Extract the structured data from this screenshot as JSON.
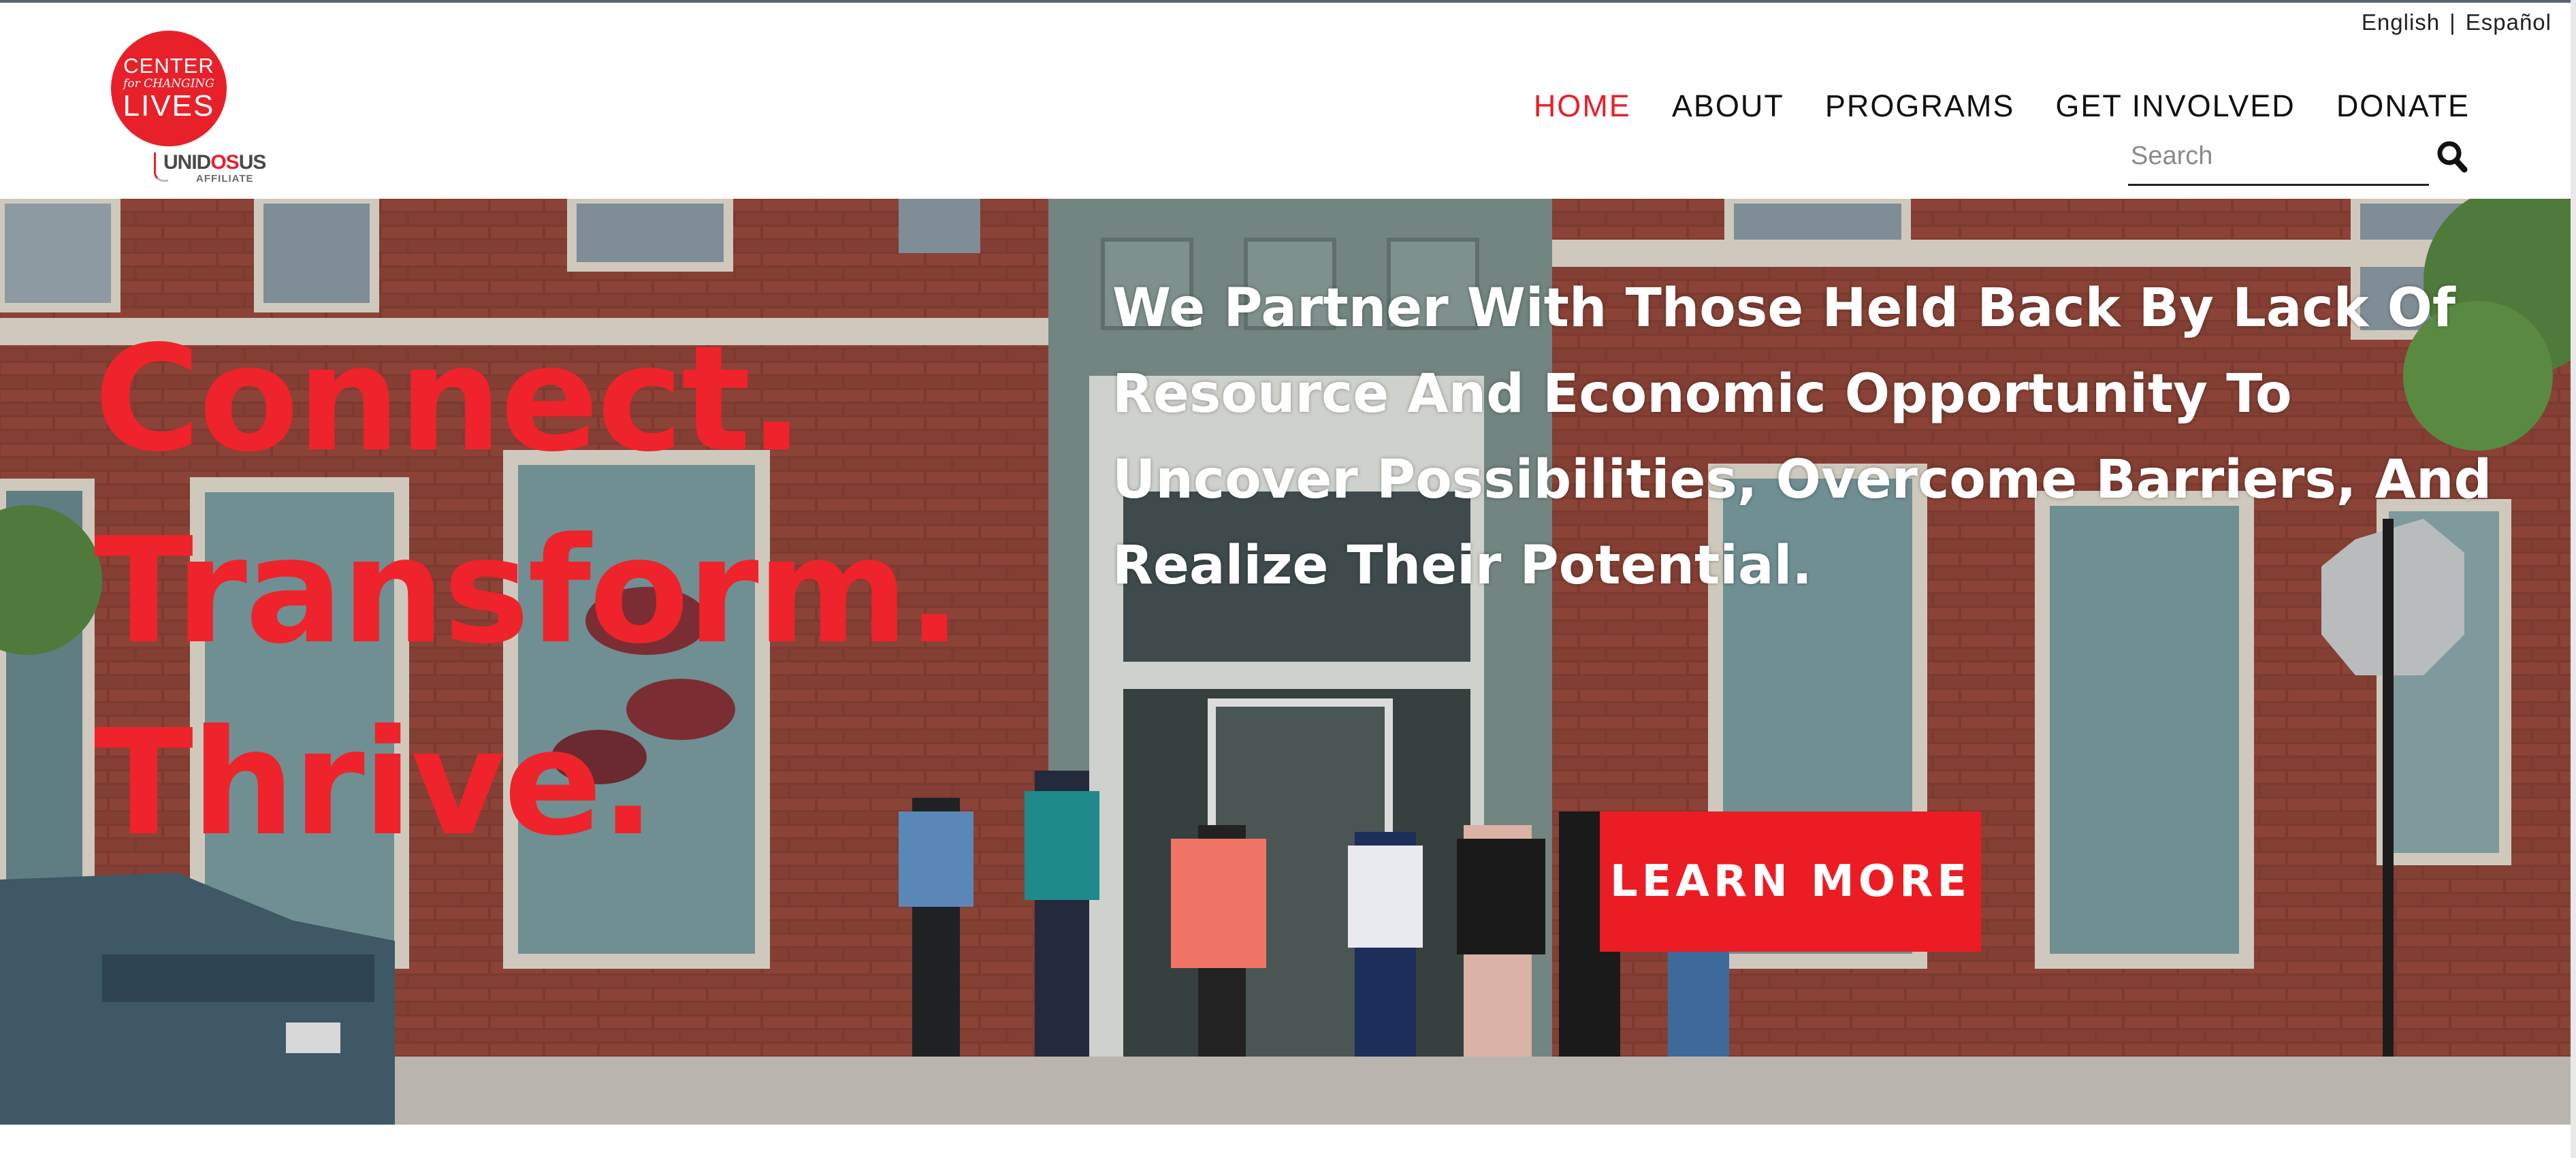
{
  "language": {
    "english": "English",
    "separator": "|",
    "spanish": "Español"
  },
  "logo": {
    "line1": "CENTER",
    "line2": "for CHANGING",
    "line3": "LIVES"
  },
  "affiliate": {
    "brand_a": "UNID",
    "brand_b": "OS",
    "brand_c": "US",
    "sub": "AFFILIATE"
  },
  "nav": {
    "home": "HOME",
    "about": "ABOUT",
    "programs": "PROGRAMS",
    "get_involved": "GET INVOLVED",
    "donate": "DONATE"
  },
  "search": {
    "placeholder": "Search",
    "value": ""
  },
  "hero": {
    "tagline": [
      "Connect.",
      "Transform.",
      "Thrive."
    ],
    "mission": "We Partner With Those Held Back By Lack Of Resource And Economic Opportunity To Uncover Possibilities, Overcome Barriers, And Realize Their Potential.",
    "button": "LEARN MORE"
  },
  "colors": {
    "brand_red": "#e8202a",
    "nav_active": "#e8202a",
    "text_dark": "#111111"
  },
  "icons": {
    "search": "search-icon"
  }
}
